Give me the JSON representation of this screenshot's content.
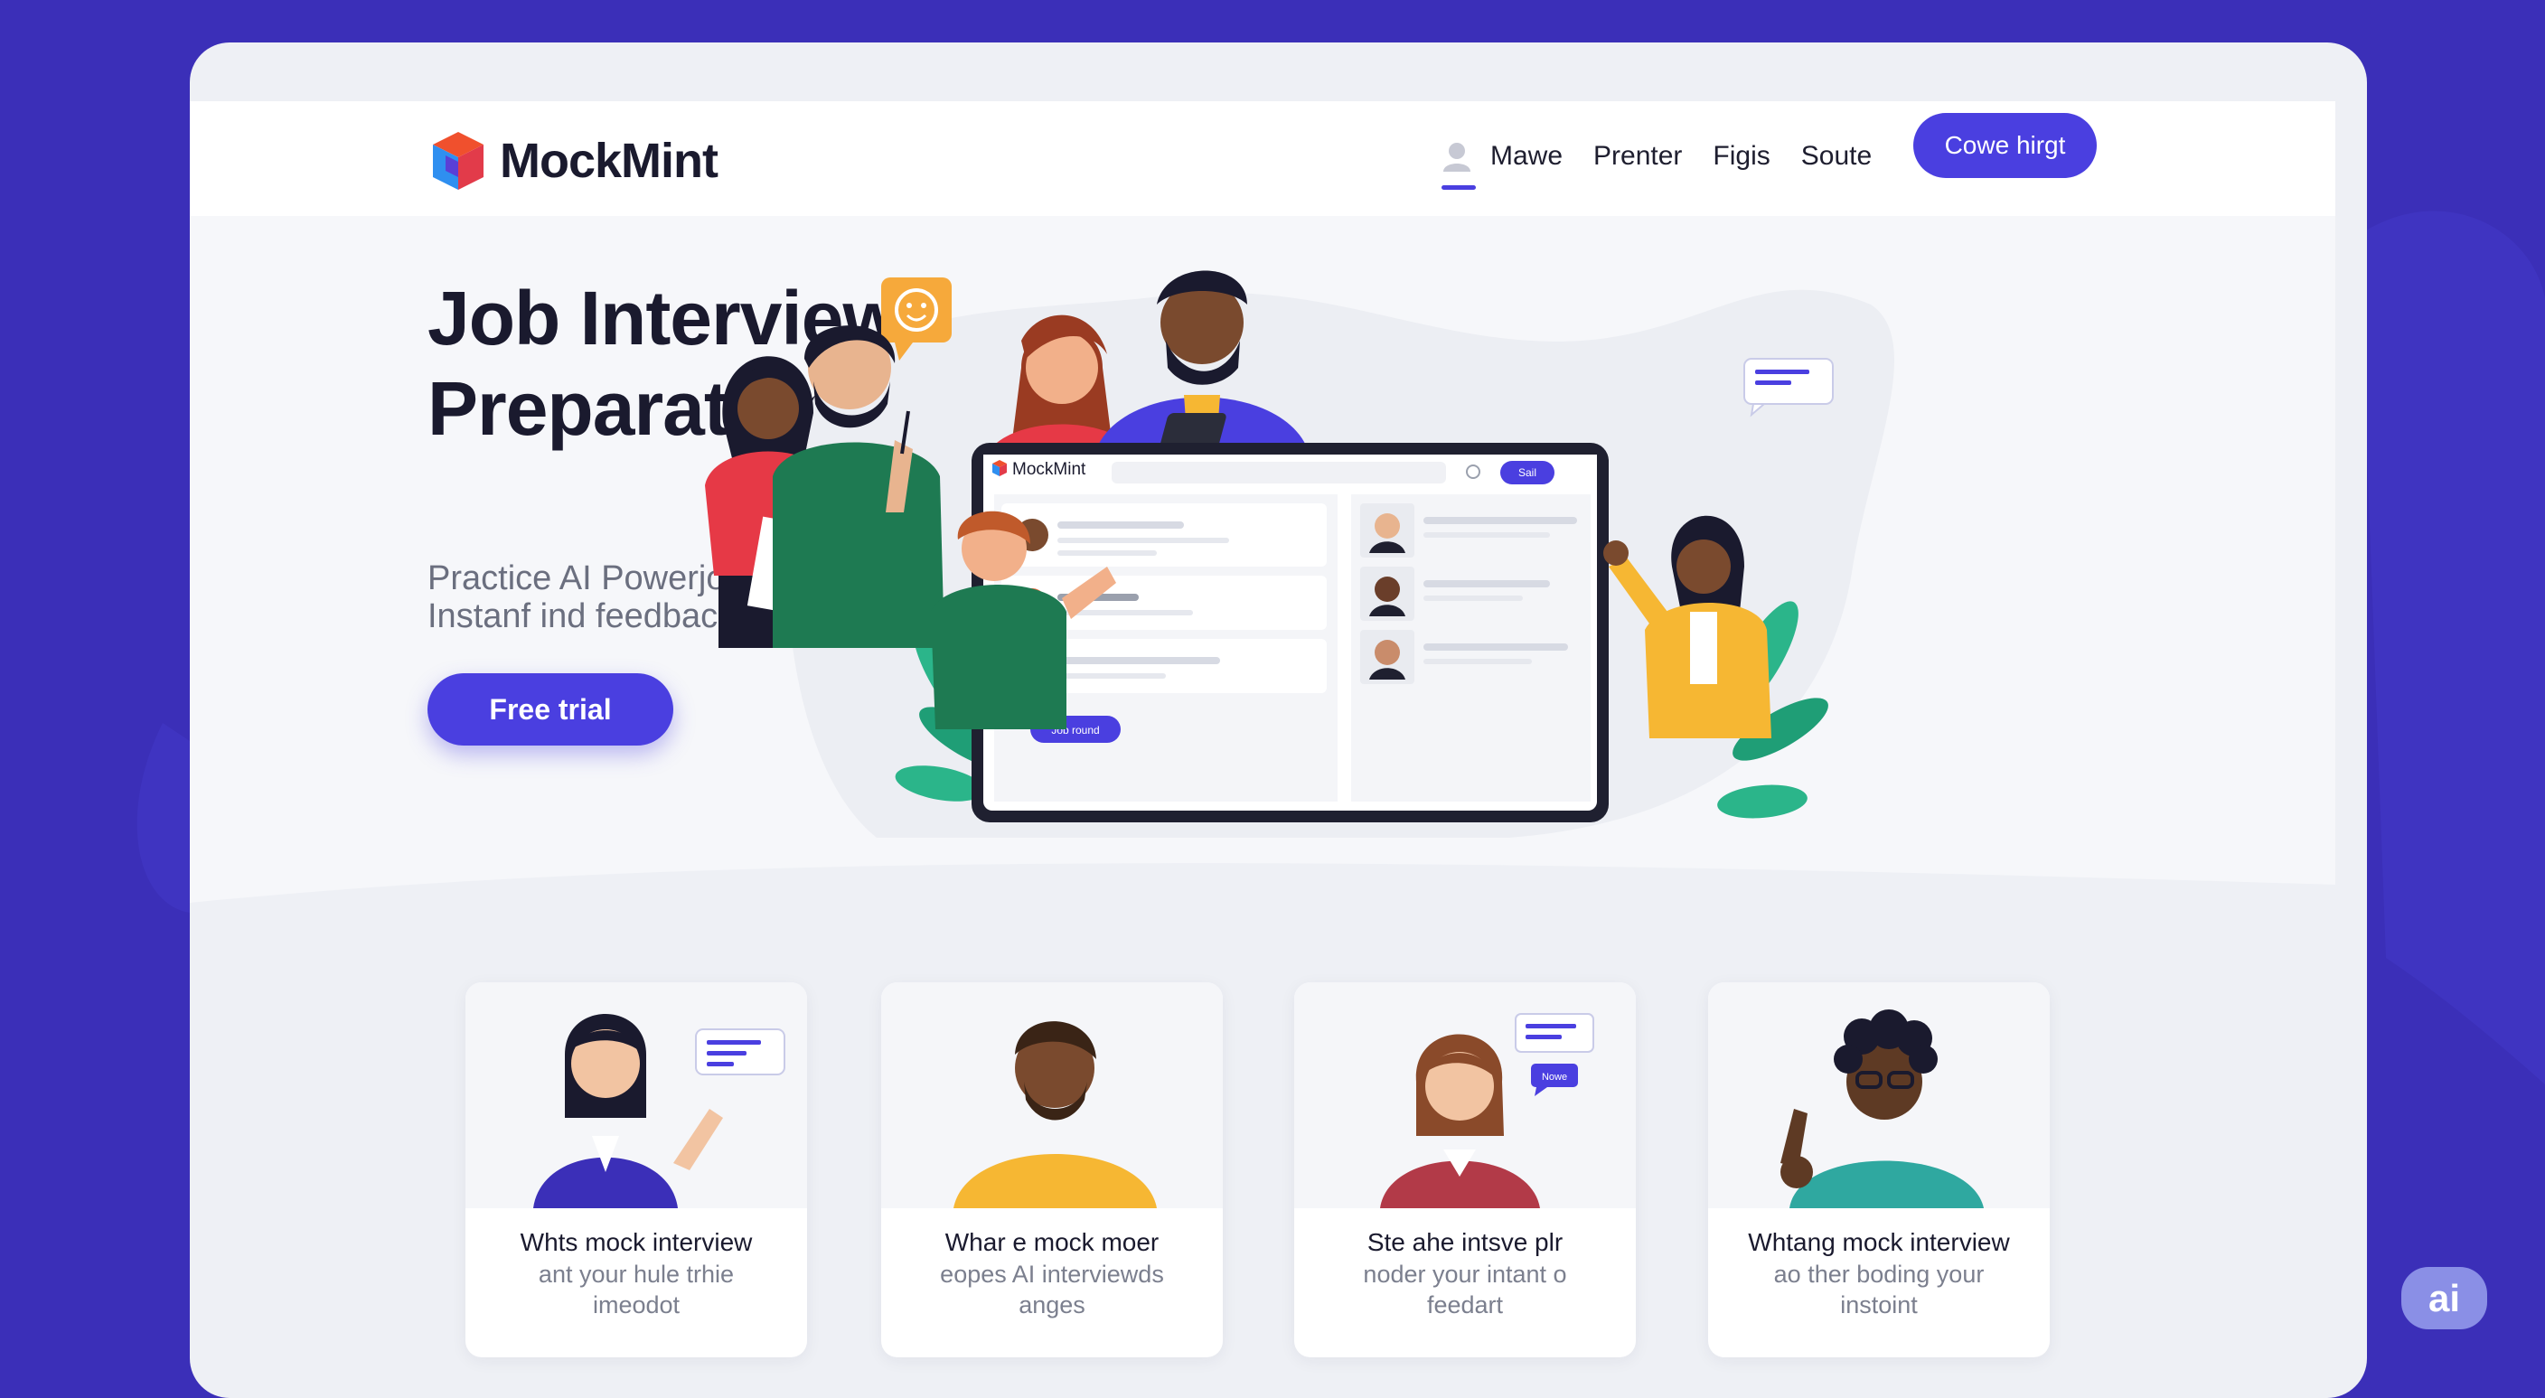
{
  "brand": {
    "name": "MockMint",
    "accent": "#4a3fe0",
    "background": "#3b2fb8"
  },
  "nav": {
    "items": [
      {
        "label": "Mawe",
        "active": true
      },
      {
        "label": "Prenter",
        "active": false
      },
      {
        "label": "Figis",
        "active": false
      },
      {
        "label": "Soute",
        "active": false
      }
    ],
    "cta_label": "Cowe hirgt"
  },
  "hero": {
    "title_line1": "Job Interview",
    "title_line2": "Preparation",
    "subtitle_line1": "Practice AI Powerjod interview",
    "subtitle_line2": "Instanf ind feedback",
    "button_label": "Free trial"
  },
  "screen": {
    "brand": "MockMint",
    "button_label": "Sail",
    "small_button_label": "Job round"
  },
  "bubble": {
    "small_label": "Nowe"
  },
  "cards": [
    {
      "title": "Whts mock interview",
      "desc_line1": "ant your hule trhie",
      "desc_line2": "imeodot"
    },
    {
      "title": "Whar e mock moer",
      "desc_line1": "eopes AI interviewds",
      "desc_line2": "anges"
    },
    {
      "title": "Ste ahe intsve plr",
      "desc_line1": "noder your intant o",
      "desc_line2": "feedart"
    },
    {
      "title": "Whtang mock interview",
      "desc_line1": "ao ther boding your",
      "desc_line2": "instoint"
    }
  ],
  "badge": "ai"
}
